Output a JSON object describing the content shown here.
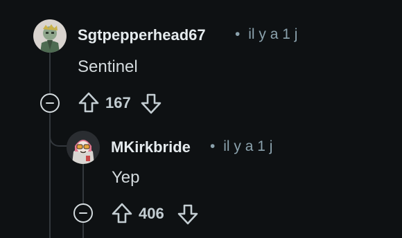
{
  "comments": [
    {
      "username": "Sgtpepperhead67",
      "separator": "•",
      "time": "il y a 1 j",
      "body": "Sentinel",
      "score": "167"
    },
    {
      "username": "MKirkbride",
      "separator": "•",
      "time": "il y a 1 j",
      "body": "Yep",
      "score": "406"
    }
  ],
  "icons": {
    "collapse": "collapse-minus-icon",
    "upvote": "upvote-arrow-icon",
    "downvote": "downvote-arrow-icon"
  },
  "colors": {
    "background": "#0e1113",
    "username": "#e5ebee",
    "meta": "#8ba2ad",
    "body": "#d4dbde",
    "thread_line": "#33383d"
  }
}
